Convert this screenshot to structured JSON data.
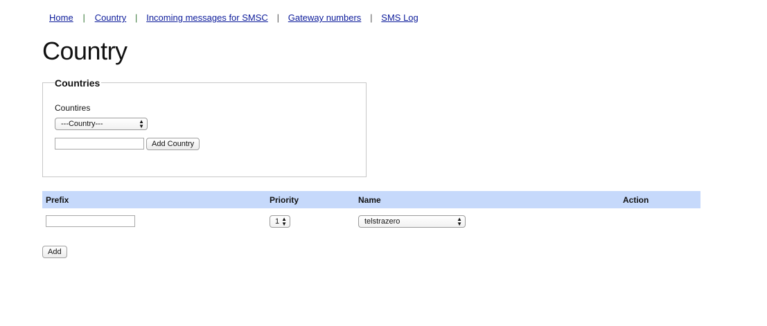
{
  "nav": {
    "items": [
      {
        "label": "Home"
      },
      {
        "label": "Country"
      },
      {
        "label": "Incoming messages for SMSC"
      },
      {
        "label": "Gateway numbers"
      },
      {
        "label": "SMS Log"
      }
    ],
    "separator": "|"
  },
  "page_title": "Country",
  "countries_section": {
    "legend": "Countries",
    "label": "Countires",
    "select_value": "---Country---",
    "input_value": "",
    "add_button": "Add Country"
  },
  "table": {
    "headers": {
      "prefix": "Prefix",
      "priority": "Priority",
      "name": "Name",
      "action": "Action"
    },
    "row": {
      "prefix_value": "",
      "priority_value": "1",
      "name_value": "telstrazero"
    }
  },
  "add_button": "Add",
  "icons": {
    "select_arrows": "up-down-chevron-icon"
  }
}
